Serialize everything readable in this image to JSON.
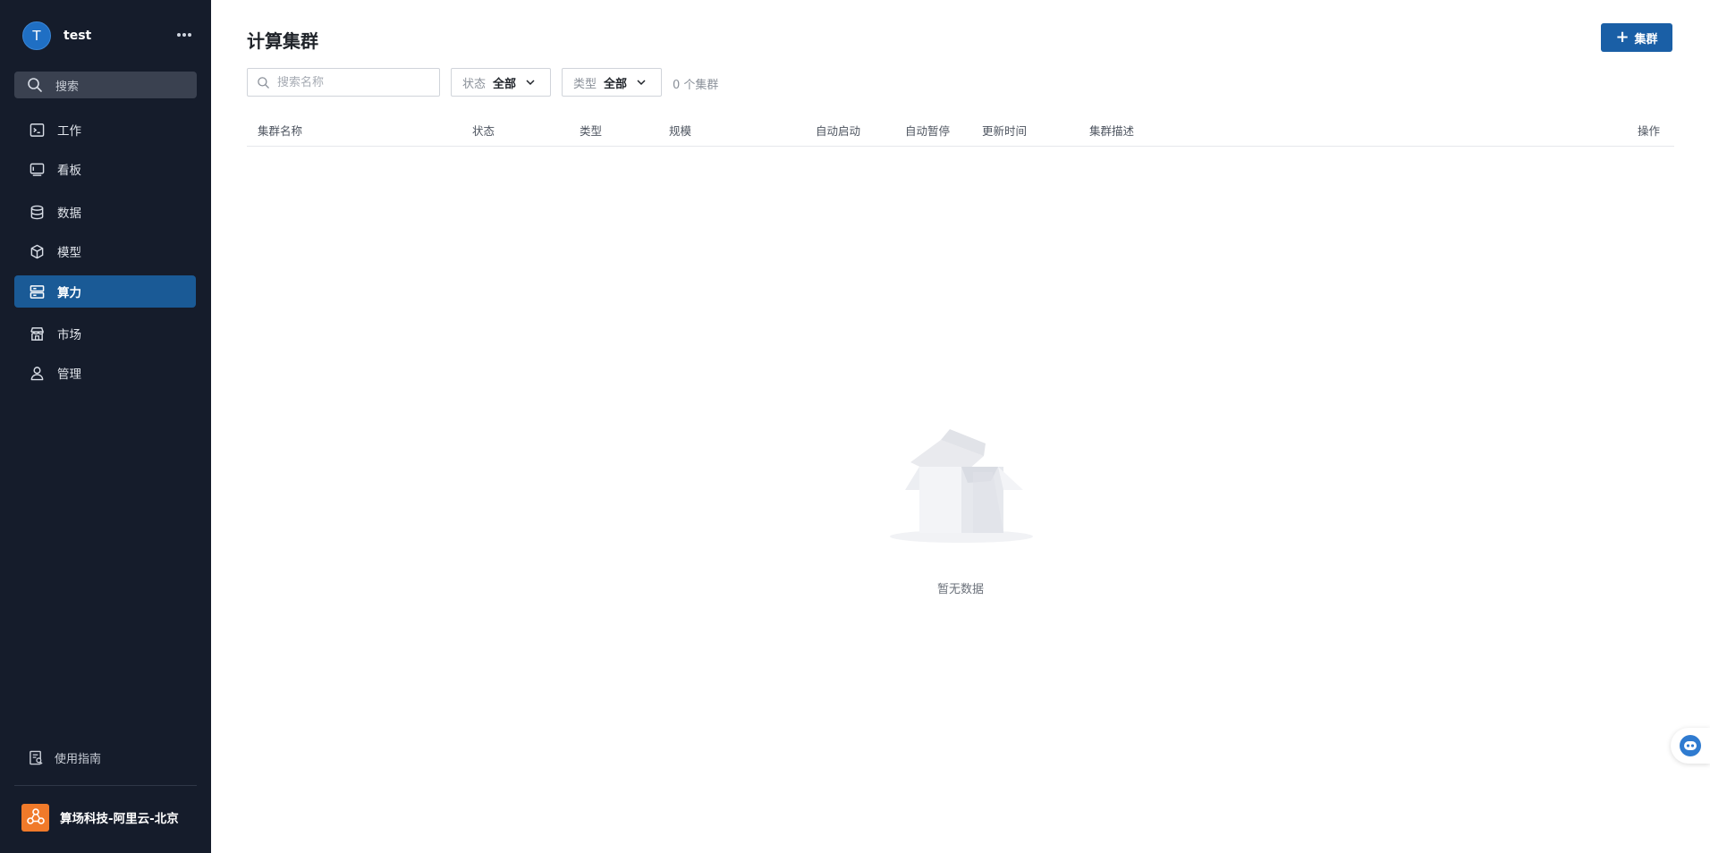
{
  "user": {
    "avatar_letter": "T",
    "name": "test",
    "more_label": "•••"
  },
  "sidebar": {
    "search_label": "搜索",
    "items": [
      {
        "label": "工作",
        "icon": "terminal-icon",
        "active": false
      },
      {
        "label": "看板",
        "icon": "dashboard-icon",
        "active": false
      },
      {
        "label": "数据",
        "icon": "database-icon",
        "active": false
      },
      {
        "label": "模型",
        "icon": "cube-icon",
        "active": false
      },
      {
        "label": "算力",
        "icon": "server-icon",
        "active": true
      },
      {
        "label": "市场",
        "icon": "store-icon",
        "active": false
      },
      {
        "label": "管理",
        "icon": "user-icon",
        "active": false
      }
    ],
    "guide_label": "使用指南",
    "org_name": "算场科技-阿里云-北京"
  },
  "main": {
    "title": "计算集群",
    "add_button_label": "集群",
    "search_placeholder": "搜索名称",
    "filters": [
      {
        "key": "状态",
        "value": "全部"
      },
      {
        "key": "类型",
        "value": "全部"
      }
    ],
    "count_text": "0 个集群",
    "columns": [
      "集群名称",
      "状态",
      "类型",
      "规模",
      "自动启动",
      "自动暂停",
      "更新时间",
      "集群描述",
      "操作"
    ],
    "empty_text": "暂无数据"
  },
  "colors": {
    "sidebar_bg": "#151c2b",
    "active_nav_bg": "#1a5a96",
    "primary_button": "#1a5fa6",
    "org_logo": "#f07a2a"
  }
}
